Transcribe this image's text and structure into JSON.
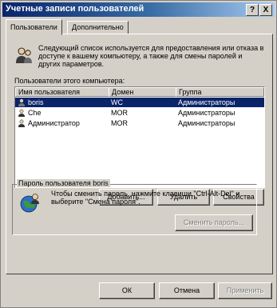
{
  "window": {
    "title": "Учетные записи пользователей",
    "help_glyph": "?",
    "close_glyph": "X"
  },
  "tabs": [
    {
      "label": "Пользователи",
      "active": true
    },
    {
      "label": "Дополнительно",
      "active": false
    }
  ],
  "intro": {
    "icon": "users-icon",
    "text": "Следующий список используется для предоставления или отказа в доступе к вашему компьютеру, а также для смены паролей и других параметров."
  },
  "users_list": {
    "label": "Пользователи этого компьютера:",
    "columns": [
      "Имя пользователя",
      "Домен",
      "Группа"
    ],
    "rows": [
      {
        "name": "boris",
        "domain": "WC",
        "group": "Администраторы",
        "selected": true
      },
      {
        "name": "Che",
        "domain": "MOR",
        "group": "Администраторы",
        "selected": false
      },
      {
        "name": "Администратор",
        "domain": "MOR",
        "group": "Администраторы",
        "selected": false
      }
    ]
  },
  "list_buttons": {
    "add": "Добавить...",
    "remove": "Удалить",
    "properties": "Свойства"
  },
  "password_group": {
    "title": "Пароль пользователя boris",
    "icon": "globe-user-icon",
    "text": "Чтобы сменить пароль, нажмите клавиши \"Ctrl-Alt-Del\" и выберите \"Смена пароля\".",
    "change_button": "Сменить пароль..."
  },
  "dialog_buttons": {
    "ok": "ОК",
    "cancel": "Отмена",
    "apply": "Применить"
  },
  "colors": {
    "face": "#d4d0c8",
    "title_start": "#0a246a",
    "title_end": "#a6caf0",
    "selection": "#0a246a"
  }
}
